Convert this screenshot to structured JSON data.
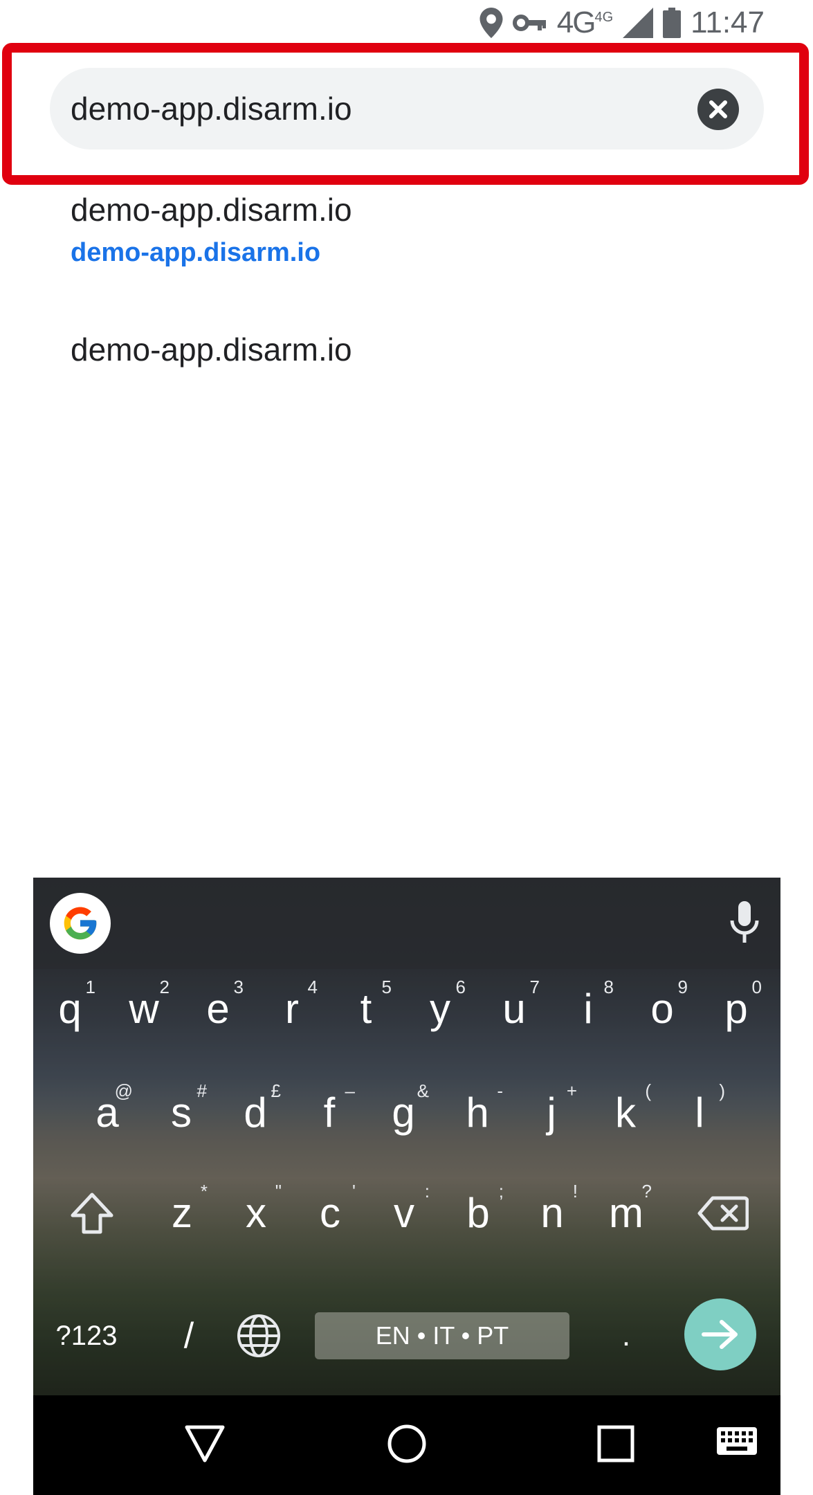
{
  "status_bar": {
    "network": "4G",
    "network_sup": "4G",
    "time": "11:47",
    "icons": [
      "location-icon",
      "vpn-key-icon",
      "signal-icon",
      "battery-icon"
    ]
  },
  "omnibox": {
    "value": "demo-app.disarm.io",
    "clear_icon": "clear-icon",
    "highlight_color": "#e0000f"
  },
  "suggestions": [
    {
      "title": "demo-app.disarm.io",
      "url": "demo-app.disarm.io"
    },
    {
      "title": "demo-app.disarm.io"
    }
  ],
  "keyboard": {
    "rows": [
      [
        {
          "key": "q",
          "hint": "1"
        },
        {
          "key": "w",
          "hint": "2"
        },
        {
          "key": "e",
          "hint": "3"
        },
        {
          "key": "r",
          "hint": "4"
        },
        {
          "key": "t",
          "hint": "5"
        },
        {
          "key": "y",
          "hint": "6"
        },
        {
          "key": "u",
          "hint": "7"
        },
        {
          "key": "i",
          "hint": "8"
        },
        {
          "key": "o",
          "hint": "9"
        },
        {
          "key": "p",
          "hint": "0"
        }
      ],
      [
        {
          "key": "a",
          "hint": "@"
        },
        {
          "key": "s",
          "hint": "#"
        },
        {
          "key": "d",
          "hint": "£"
        },
        {
          "key": "f",
          "hint": "–"
        },
        {
          "key": "g",
          "hint": "&"
        },
        {
          "key": "h",
          "hint": "-"
        },
        {
          "key": "j",
          "hint": "+"
        },
        {
          "key": "k",
          "hint": "("
        },
        {
          "key": "l",
          "hint": ")"
        }
      ],
      [
        {
          "key": "z",
          "hint": "*"
        },
        {
          "key": "x",
          "hint": "\""
        },
        {
          "key": "c",
          "hint": "'"
        },
        {
          "key": "v",
          "hint": ":"
        },
        {
          "key": "b",
          "hint": ";"
        },
        {
          "key": "n",
          "hint": "!"
        },
        {
          "key": "m",
          "hint": "?"
        }
      ]
    ],
    "symbols_label": "?123",
    "slash_label": "/",
    "space_label": "EN • IT • PT",
    "period_label": ".",
    "accent_color": "#7fcfc3"
  },
  "nav_bar": {
    "icons": [
      "back-icon",
      "home-icon",
      "recents-icon",
      "keyboard-switch-icon"
    ]
  }
}
